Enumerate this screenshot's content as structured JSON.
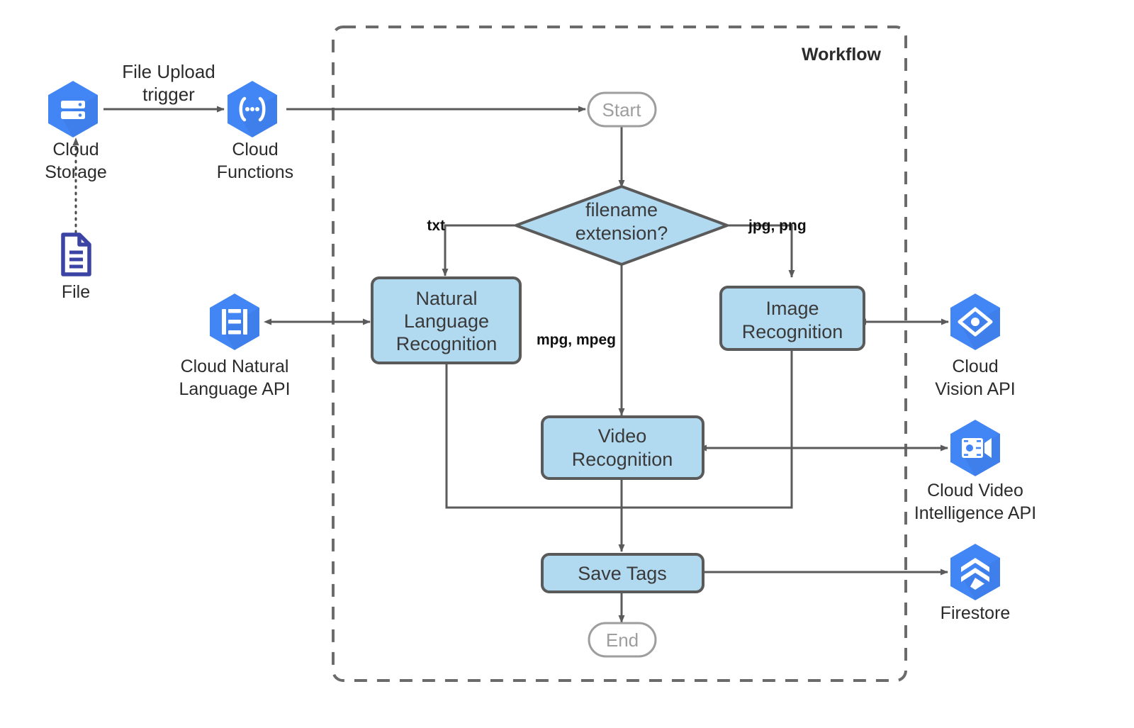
{
  "diagram": {
    "title": "Workflow",
    "group_box_label": "Workflow",
    "colors": {
      "process_fill": "#b1d9f0",
      "process_stroke": "#5a5a5a",
      "terminal_stroke": "#9e9e9e",
      "terminal_text": "#9e9e9e",
      "edge": "#5a5a5a",
      "gcp_blue": "#4285f4",
      "gcp_blue_shadow": "#3a76dd",
      "file_icon": "#3b44a5",
      "text": "#2b2b2b"
    },
    "external_services": [
      {
        "id": "cloud-storage",
        "icon": "cloud-storage-icon",
        "label_lines": [
          "Cloud",
          "Storage"
        ],
        "label": "Cloud Storage"
      },
      {
        "id": "cloud-functions",
        "icon": "cloud-functions-icon",
        "label_lines": [
          "Cloud",
          "Functions"
        ],
        "label": "Cloud Functions"
      },
      {
        "id": "file",
        "icon": "file-icon",
        "label_lines": [
          "File"
        ],
        "label": "File"
      },
      {
        "id": "cloud-natural-language-api",
        "icon": "cloud-natural-language-api-icon",
        "label_lines": [
          "Cloud Natural",
          "Language API"
        ],
        "label": "Cloud Natural Language API"
      },
      {
        "id": "cloud-vision-api",
        "icon": "cloud-vision-api-icon",
        "label_lines": [
          "Cloud",
          "Vision API"
        ],
        "label": "Cloud Vision API"
      },
      {
        "id": "cloud-video-intelligence-api",
        "icon": "cloud-video-intelligence-api-icon",
        "label_lines": [
          "Cloud Video",
          "Intelligence API"
        ],
        "label": "Cloud Video Intelligence API"
      },
      {
        "id": "firestore",
        "icon": "firestore-icon",
        "label_lines": [
          "Firestore"
        ],
        "label": "Firestore"
      }
    ],
    "nodes": [
      {
        "id": "start",
        "type": "terminal",
        "label": "Start"
      },
      {
        "id": "filename-extension",
        "type": "decision",
        "label_lines": [
          "filename",
          "extension?"
        ],
        "label": "filename extension?"
      },
      {
        "id": "natural-language-recognition",
        "type": "process",
        "label_lines": [
          "Natural",
          "Language",
          "Recognition"
        ],
        "label": "Natural Language Recognition"
      },
      {
        "id": "image-recognition",
        "type": "process",
        "label_lines": [
          "Image",
          "Recognition"
        ],
        "label": "Image Recognition"
      },
      {
        "id": "video-recognition",
        "type": "process",
        "label_lines": [
          "Video",
          "Recognition"
        ],
        "label": "Video Recognition"
      },
      {
        "id": "save-tags",
        "type": "process",
        "label_lines": [
          "Save Tags"
        ],
        "label": "Save Tags"
      },
      {
        "id": "end",
        "type": "terminal",
        "label": "End"
      }
    ],
    "edge_labels": {
      "file_upload_trigger": [
        "File Upload",
        "trigger"
      ],
      "file_upload_trigger_text": "File Upload trigger",
      "txt": "txt",
      "jpg_png": "jpg, png",
      "mpg_mpeg": "mpg, mpeg"
    },
    "edges": [
      {
        "from": "cloud-storage",
        "to": "cloud-functions",
        "label": "File Upload trigger",
        "arrow": "single"
      },
      {
        "from": "file",
        "to": "cloud-storage",
        "style": "dotted",
        "arrow": "single"
      },
      {
        "from": "cloud-functions",
        "to": "start",
        "arrow": "single"
      },
      {
        "from": "start",
        "to": "filename-extension",
        "arrow": "single"
      },
      {
        "from": "filename-extension",
        "to": "natural-language-recognition",
        "label": "txt",
        "arrow": "single"
      },
      {
        "from": "filename-extension",
        "to": "image-recognition",
        "label": "jpg, png",
        "arrow": "single"
      },
      {
        "from": "filename-extension",
        "to": "video-recognition",
        "label": "mpg, mpeg",
        "arrow": "single"
      },
      {
        "from": "natural-language-recognition",
        "to": "cloud-natural-language-api",
        "arrow": "double"
      },
      {
        "from": "image-recognition",
        "to": "cloud-vision-api",
        "arrow": "double"
      },
      {
        "from": "video-recognition",
        "to": "cloud-video-intelligence-api",
        "arrow": "double"
      },
      {
        "from": "natural-language-recognition",
        "to": "save-tags",
        "arrow": "single"
      },
      {
        "from": "image-recognition",
        "to": "save-tags",
        "arrow": "single"
      },
      {
        "from": "video-recognition",
        "to": "save-tags",
        "arrow": "single"
      },
      {
        "from": "save-tags",
        "to": "firestore",
        "arrow": "single"
      },
      {
        "from": "save-tags",
        "to": "end",
        "arrow": "single"
      }
    ]
  }
}
